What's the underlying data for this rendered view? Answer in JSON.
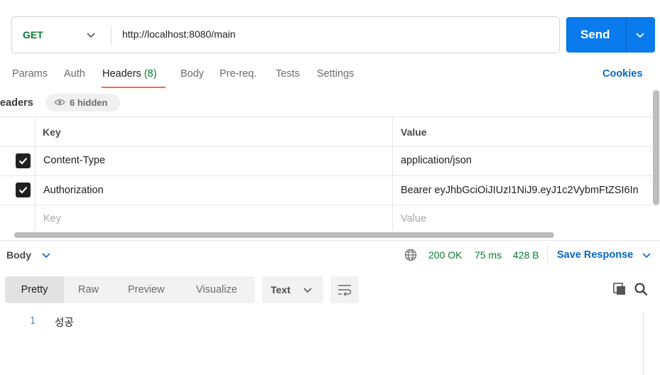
{
  "request": {
    "method": "GET",
    "url": "http://localhost:8080/main",
    "send_label": "Send"
  },
  "tabs": [
    {
      "label": "Params"
    },
    {
      "label": "Auth"
    },
    {
      "label": "Headers",
      "count": "(8)",
      "active": true
    },
    {
      "label": "Body"
    },
    {
      "label": "Pre-req."
    },
    {
      "label": "Tests"
    },
    {
      "label": "Settings"
    }
  ],
  "cookies_label": "Cookies",
  "headers_section": {
    "title": "leaders",
    "hidden_label": "6 hidden",
    "columns": {
      "key": "Key",
      "value": "Value"
    },
    "rows": [
      {
        "checked": true,
        "key": "Content-Type",
        "value": "application/json"
      },
      {
        "checked": true,
        "key": "Authorization",
        "value": "Bearer eyJhbGciOiJIUzI1NiJ9.eyJ1c2VybmFtZSI6In"
      }
    ],
    "placeholder": {
      "key": "Key",
      "value": "Value"
    }
  },
  "response": {
    "body_label": "Body",
    "status": "200 OK",
    "time": "75 ms",
    "size": "428 B",
    "save_label": "Save Response",
    "views": [
      "Pretty",
      "Raw",
      "Preview",
      "Visualize"
    ],
    "format": "Text",
    "lines": [
      {
        "no": "1",
        "text": "성공"
      }
    ]
  },
  "colors": {
    "accent": "#097bed",
    "success": "#0b7a35",
    "active_tab": "#f26b3a",
    "link": "#0a66c2"
  }
}
